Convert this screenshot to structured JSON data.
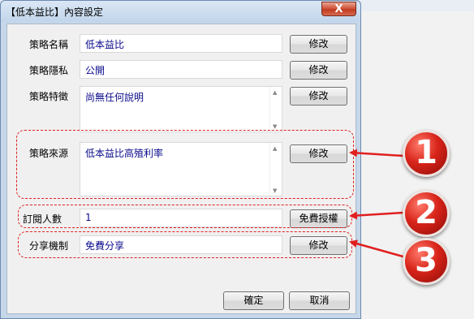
{
  "window": {
    "title": "【低本益比】內容設定",
    "close_glyph": "X"
  },
  "rows": [
    {
      "id": "name",
      "label": "策略名稱",
      "value": "低本益比",
      "button": "修改"
    },
    {
      "id": "privacy",
      "label": "策略隱私",
      "value": "公開",
      "button": "修改"
    },
    {
      "id": "feature",
      "label": "策略特徵",
      "value": "尚無任何說明",
      "button": "修改"
    },
    {
      "id": "source",
      "label": "策略來源",
      "value": "低本益比高殖利率",
      "button": "修改"
    },
    {
      "id": "subscribers",
      "label": "訂閱人數",
      "value": "1",
      "button": "免費授權"
    },
    {
      "id": "sharing",
      "label": "分享機制",
      "value": "免費分享",
      "button": "修改"
    }
  ],
  "footer": {
    "ok": "確定",
    "cancel": "取消"
  },
  "callouts": [
    "1",
    "2",
    "3"
  ],
  "colors": {
    "value_text": "#0a0a8c",
    "highlight": "#e02020",
    "badge": "#d8241a"
  }
}
